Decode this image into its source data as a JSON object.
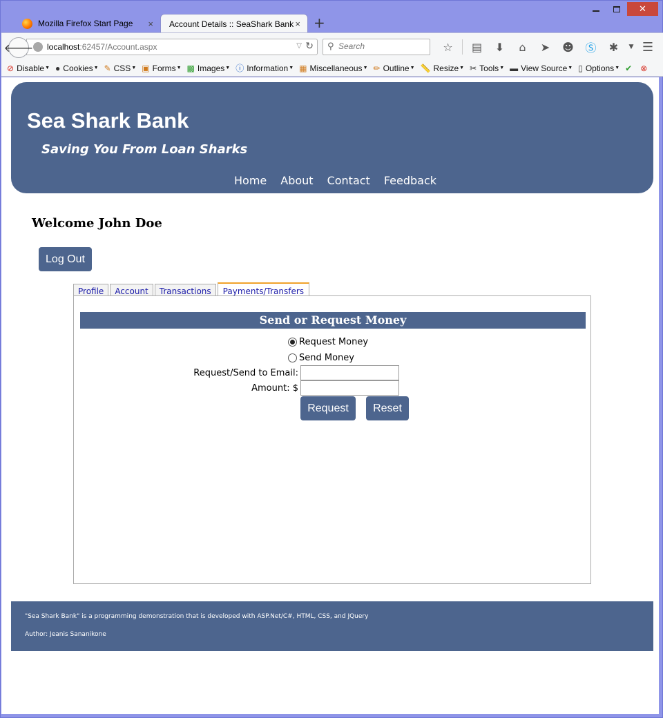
{
  "browser": {
    "tabs": [
      {
        "title": "Mozilla Firefox Start Page",
        "close": "×"
      },
      {
        "title": "Account Details :: SeaShark Bank",
        "close": "×"
      }
    ],
    "new_tab": "+",
    "url_host": "localhost",
    "url_rest": ":62457/Account.aspx",
    "search_placeholder": "Search"
  },
  "dev_toolbar": {
    "items": [
      "Disable",
      "Cookies",
      "CSS",
      "Forms",
      "Images",
      "Information",
      "Miscellaneous",
      "Outline",
      "Resize",
      "Tools",
      "View Source",
      "Options"
    ]
  },
  "site": {
    "title": "Sea Shark Bank",
    "tagline": "Saving You From Loan Sharks",
    "nav": [
      "Home",
      "About",
      "Contact",
      "Feedback"
    ]
  },
  "account": {
    "welcome": "Welcome John Doe",
    "logout_label": "Log Out",
    "tabs": [
      "Profile",
      "Account",
      "Transactions",
      "Payments/Transfers"
    ],
    "active_tab": "Payments/Transfers"
  },
  "transfer_form": {
    "heading": "Send or Request Money",
    "option_request": "Request Money",
    "option_send": "Send Money",
    "selected": "Request Money",
    "email_label": "Request/Send to Email:",
    "email_value": "",
    "amount_label": "Amount: $",
    "amount_value": "",
    "request_label": "Request",
    "reset_label": "Reset"
  },
  "footer": {
    "line1": "\"Sea Shark Bank\" is a programming demonstration that is developed with ASP.Net/C#, HTML, CSS, and JQuery",
    "line2": "Author: Jeanis Sananikone"
  },
  "colors": {
    "brand": "#4d658e",
    "tab_accent": "#f0a22a",
    "link": "#1a1aa8"
  }
}
